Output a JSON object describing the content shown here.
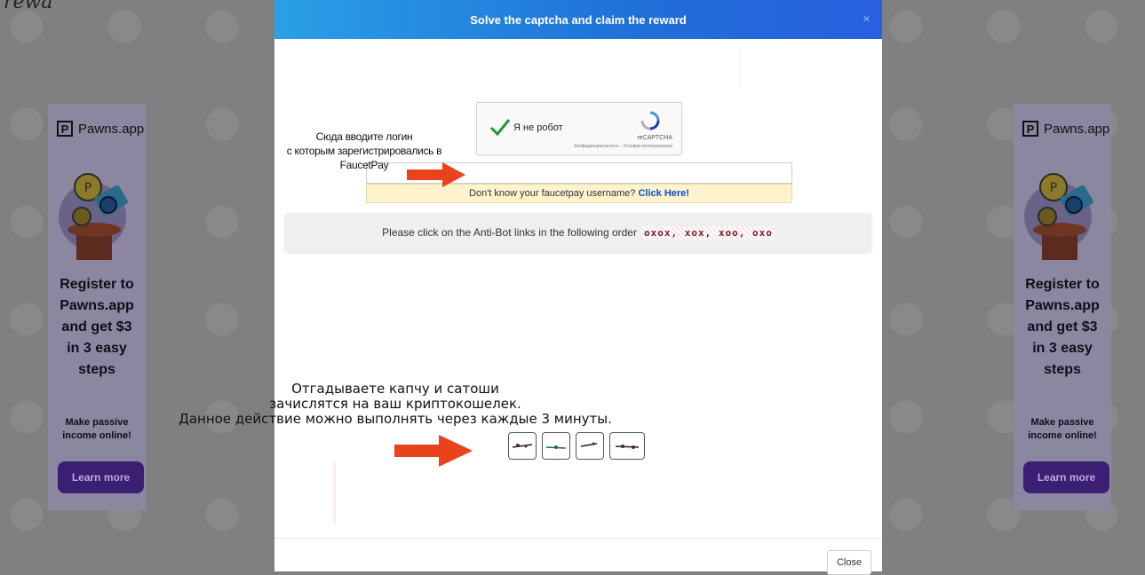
{
  "background": {
    "logo_text": "rewa"
  },
  "ads": {
    "brand": "Pawns.app",
    "headline": [
      "Register to",
      "Pawns.app",
      "and get $3",
      "in 3 easy",
      "steps"
    ],
    "subtext": [
      "Make passive",
      "income online!"
    ],
    "button": "Learn more"
  },
  "modal": {
    "title": "Solve the captcha and claim the reward",
    "close_icon": "×",
    "recaptcha": {
      "checkbox_label": "Я не робот",
      "brand": "reCAPTCHA",
      "links": "Конфиденциальность - Условия использования"
    },
    "username_placeholder": "",
    "help_text": "Don't know your faucetpay username?",
    "help_link": "Click Here!",
    "antibot_prompt": "Please click on the Anti-Bot links in the following order",
    "antibot_order": "oxox, xox, xoo, oxo",
    "footer_close": "Close"
  },
  "annotations": {
    "login_hint": [
      "Сюда вводите логин",
      "с которым зарегистрировались в FaucetPay"
    ],
    "captcha_hint": [
      "Отгадываете капчу и сатоши",
      "зачислятся на ваш криптокошелек.",
      "Данное действие можно выполнять через каждые 3 минуты."
    ]
  },
  "colors": {
    "header_gradient_start": "#2aa0e6",
    "header_gradient_end": "#1f6fd8",
    "arrow": "#e8431d",
    "ad_button": "#3a1f73",
    "link": "#0050d0"
  }
}
